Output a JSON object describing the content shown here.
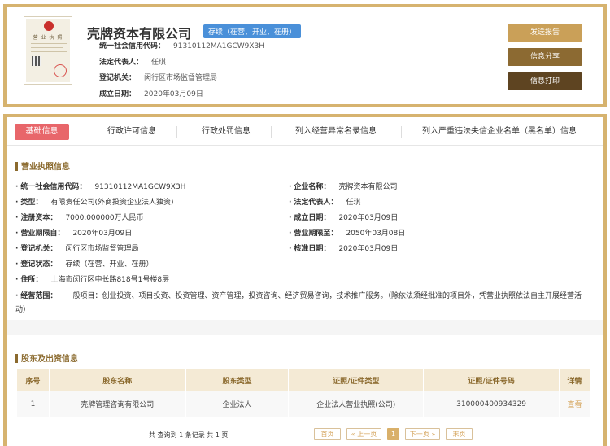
{
  "header": {
    "license_image_title": "营 业 执 照",
    "company_name": "壳牌资本有限公司",
    "status": "存续（在营、开业、在册）",
    "rows": [
      {
        "label": "统一社会信用代码：",
        "value": "91310112MA1GCW9X3H"
      },
      {
        "label": "法定代表人：",
        "value": "任琪"
      },
      {
        "label": "登记机关：",
        "value": "闵行区市场监督管理局"
      },
      {
        "label": "成立日期：",
        "value": "2020年03月09日"
      }
    ],
    "buttons": {
      "report": "发送报告",
      "share": "信息分享",
      "print": "信息打印"
    }
  },
  "tabs": [
    "基础信息",
    "行政许可信息",
    "行政处罚信息",
    "列入经营异常名录信息",
    "列入严重违法失信企业名单（黑名单）信息"
  ],
  "license_section": {
    "title": "营业执照信息",
    "left": [
      {
        "label": "统一社会信用代码：",
        "value": "91310112MA1GCW9X3H"
      },
      {
        "label": "类型：",
        "value": "有限责任公司(外商投资企业法人独资)"
      },
      {
        "label": "注册资本：",
        "value": "7000.000000万人民币"
      },
      {
        "label": "营业期限自：",
        "value": "2020年03月09日"
      },
      {
        "label": "登记机关：",
        "value": "闵行区市场监督管理局"
      },
      {
        "label": "登记状态：",
        "value": "存续（在营、开业、在册）"
      },
      {
        "label": "住所：",
        "value": "上海市闵行区申长路818号1号楼8层"
      }
    ],
    "right": [
      {
        "label": "企业名称：",
        "value": "壳牌资本有限公司"
      },
      {
        "label": "法定代表人：",
        "value": "任琪"
      },
      {
        "label": "成立日期：",
        "value": "2020年03月09日"
      },
      {
        "label": "营业期限至：",
        "value": "2050年03月08日"
      },
      {
        "label": "核准日期：",
        "value": "2020年03月09日"
      }
    ],
    "scope_label": "经营范围：",
    "scope_value": "一般项目：创业投资、项目投资、投资管理、资产管理，投资咨询、经济贸易咨询，技术推广服务。（除依法须经批准的项目外，凭营业执照依法自主开展经营活动）"
  },
  "shareholder_section": {
    "title": "股东及出资信息",
    "columns": [
      "序号",
      "股东名称",
      "股东类型",
      "证照/证件类型",
      "证照/证件号码",
      "详情"
    ],
    "rows": [
      {
        "no": "1",
        "name": "壳牌管理咨询有限公司",
        "type": "企业法人",
        "doc_type": "企业法人营业执照(公司)",
        "doc_no": "310000400934329",
        "detail": "查看"
      }
    ],
    "pager": {
      "summary": "共 查询到 1 条记录 共 1 页",
      "first": "首页",
      "prev": "« 上一页",
      "current": "1",
      "next": "下一页 »",
      "last": "末页"
    }
  }
}
